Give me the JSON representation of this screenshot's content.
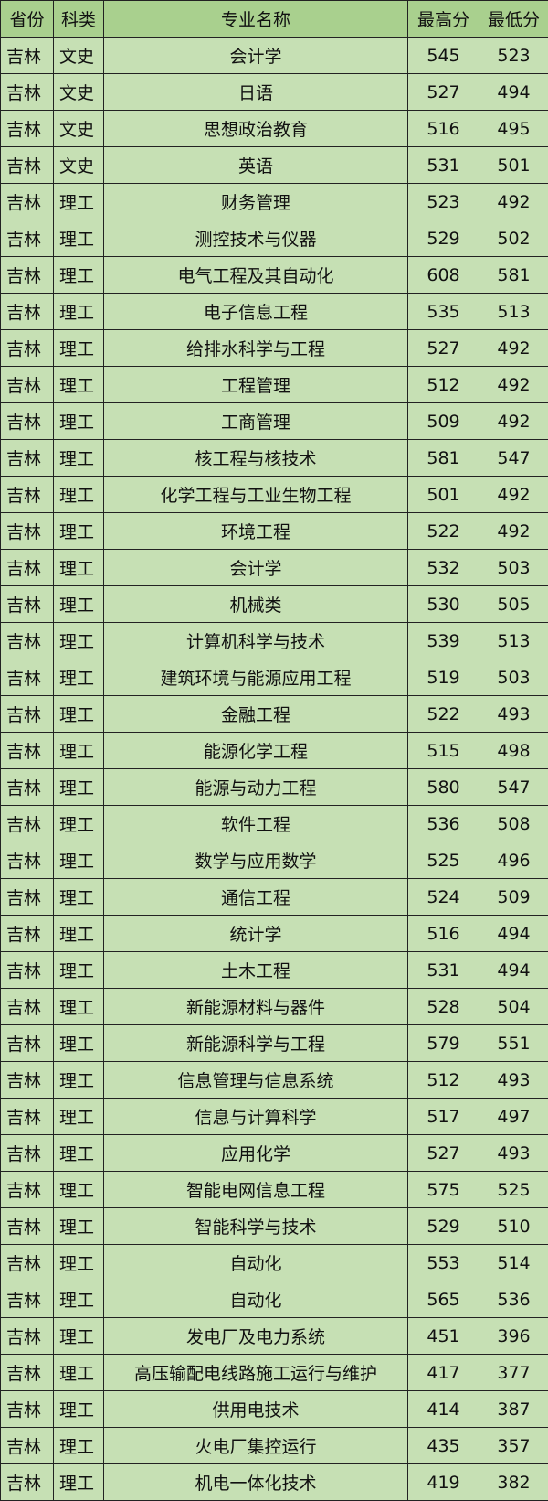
{
  "colors": {
    "header_bg": "#a9d08e",
    "row_bg": "#c6e0b4",
    "border": "#222222"
  },
  "headers": [
    "省份",
    "科类",
    "专业名称",
    "最高分",
    "最低分"
  ],
  "rows": [
    [
      "吉林",
      "文史",
      "会计学",
      "545",
      "523"
    ],
    [
      "吉林",
      "文史",
      "日语",
      "527",
      "494"
    ],
    [
      "吉林",
      "文史",
      "思想政治教育",
      "516",
      "495"
    ],
    [
      "吉林",
      "文史",
      "英语",
      "531",
      "501"
    ],
    [
      "吉林",
      "理工",
      "财务管理",
      "523",
      "492"
    ],
    [
      "吉林",
      "理工",
      "测控技术与仪器",
      "529",
      "502"
    ],
    [
      "吉林",
      "理工",
      "电气工程及其自动化",
      "608",
      "581"
    ],
    [
      "吉林",
      "理工",
      "电子信息工程",
      "535",
      "513"
    ],
    [
      "吉林",
      "理工",
      "给排水科学与工程",
      "527",
      "492"
    ],
    [
      "吉林",
      "理工",
      "工程管理",
      "512",
      "492"
    ],
    [
      "吉林",
      "理工",
      "工商管理",
      "509",
      "492"
    ],
    [
      "吉林",
      "理工",
      "核工程与核技术",
      "581",
      "547"
    ],
    [
      "吉林",
      "理工",
      "化学工程与工业生物工程",
      "501",
      "492"
    ],
    [
      "吉林",
      "理工",
      "环境工程",
      "522",
      "492"
    ],
    [
      "吉林",
      "理工",
      "会计学",
      "532",
      "503"
    ],
    [
      "吉林",
      "理工",
      "机械类",
      "530",
      "505"
    ],
    [
      "吉林",
      "理工",
      "计算机科学与技术",
      "539",
      "513"
    ],
    [
      "吉林",
      "理工",
      "建筑环境与能源应用工程",
      "519",
      "503"
    ],
    [
      "吉林",
      "理工",
      "金融工程",
      "522",
      "493"
    ],
    [
      "吉林",
      "理工",
      "能源化学工程",
      "515",
      "498"
    ],
    [
      "吉林",
      "理工",
      "能源与动力工程",
      "580",
      "547"
    ],
    [
      "吉林",
      "理工",
      "软件工程",
      "536",
      "508"
    ],
    [
      "吉林",
      "理工",
      "数学与应用数学",
      "525",
      "496"
    ],
    [
      "吉林",
      "理工",
      "通信工程",
      "524",
      "509"
    ],
    [
      "吉林",
      "理工",
      "统计学",
      "516",
      "494"
    ],
    [
      "吉林",
      "理工",
      "土木工程",
      "531",
      "494"
    ],
    [
      "吉林",
      "理工",
      "新能源材料与器件",
      "528",
      "504"
    ],
    [
      "吉林",
      "理工",
      "新能源科学与工程",
      "579",
      "551"
    ],
    [
      "吉林",
      "理工",
      "信息管理与信息系统",
      "512",
      "493"
    ],
    [
      "吉林",
      "理工",
      "信息与计算科学",
      "517",
      "497"
    ],
    [
      "吉林",
      "理工",
      "应用化学",
      "527",
      "493"
    ],
    [
      "吉林",
      "理工",
      "智能电网信息工程",
      "575",
      "525"
    ],
    [
      "吉林",
      "理工",
      "智能科学与技术",
      "529",
      "510"
    ],
    [
      "吉林",
      "理工",
      "自动化",
      "553",
      "514"
    ],
    [
      "吉林",
      "理工",
      "自动化",
      "565",
      "536"
    ],
    [
      "吉林",
      "理工",
      "发电厂及电力系统",
      "451",
      "396"
    ],
    [
      "吉林",
      "理工",
      "高压输配电线路施工运行与维护",
      "417",
      "377"
    ],
    [
      "吉林",
      "理工",
      "供用电技术",
      "414",
      "387"
    ],
    [
      "吉林",
      "理工",
      "火电厂集控运行",
      "435",
      "357"
    ],
    [
      "吉林",
      "理工",
      "机电一体化技术",
      "419",
      "382"
    ]
  ]
}
